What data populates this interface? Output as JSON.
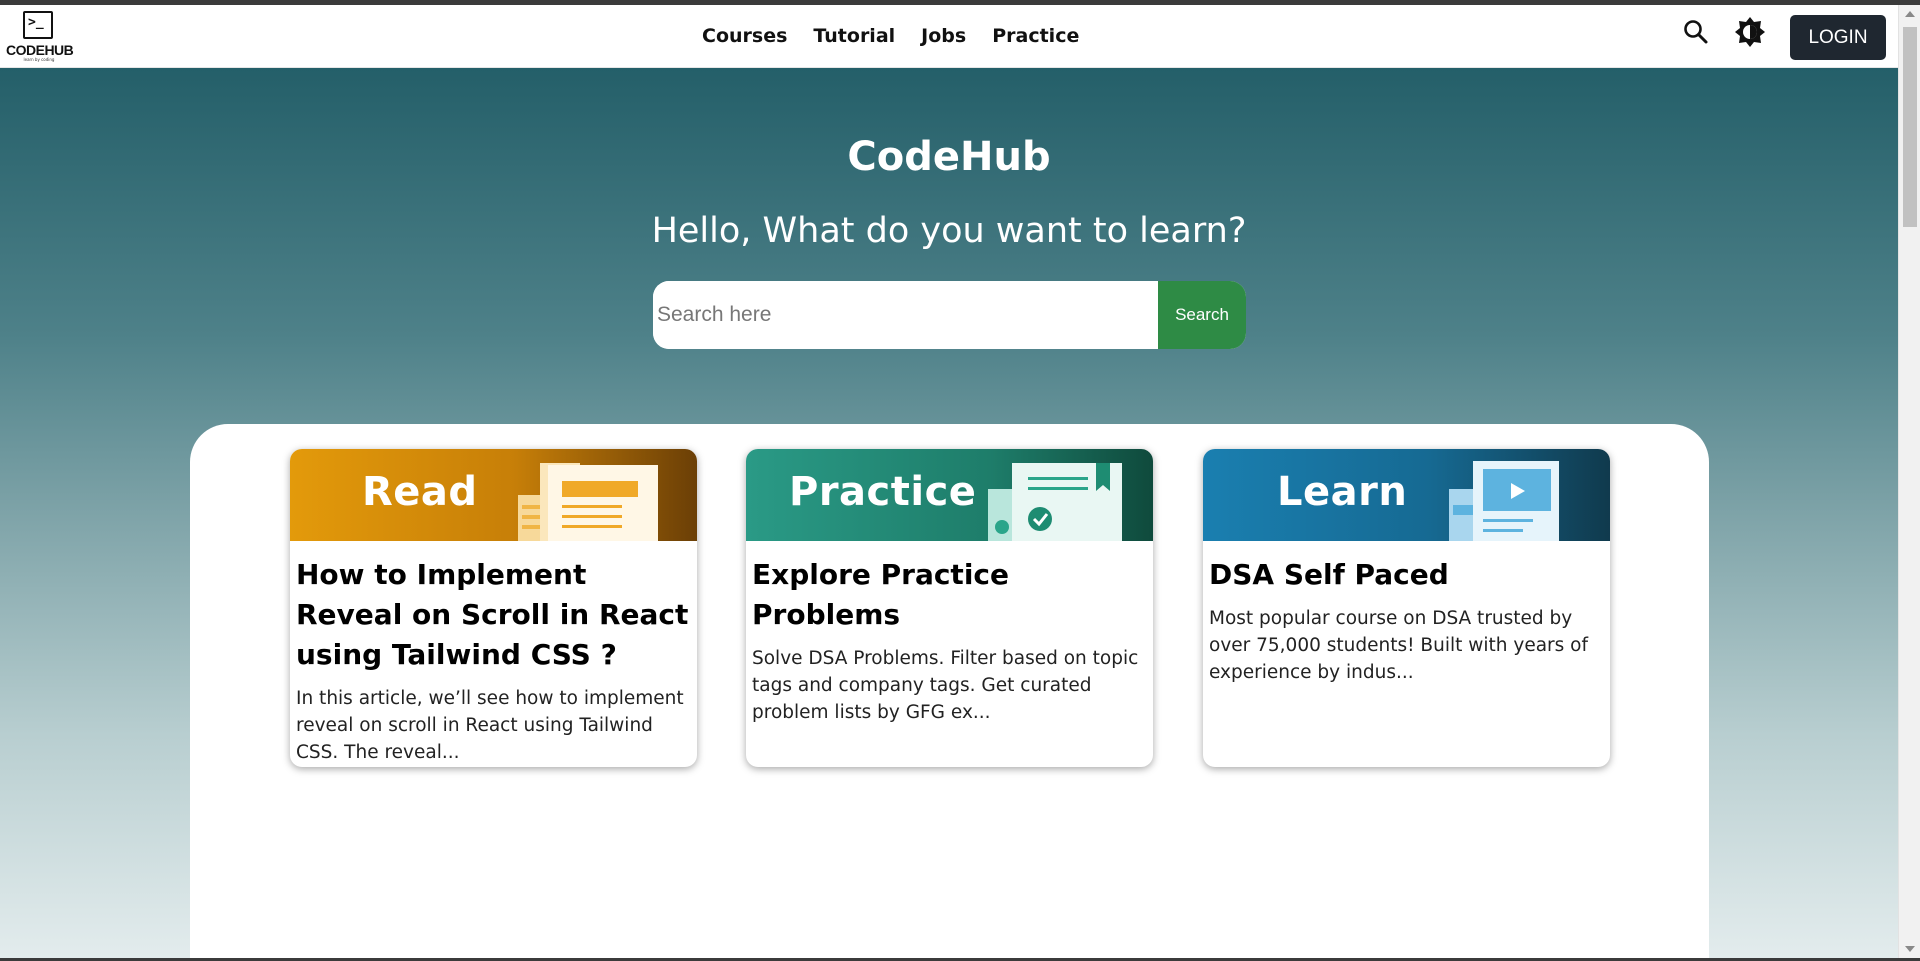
{
  "header": {
    "logo_text": "CODEHUB",
    "logo_tagline": "learn by coding",
    "nav": [
      "Courses",
      "Tutorial",
      "Jobs",
      "Practice"
    ],
    "login_label": "LOGIN",
    "icons": [
      "search-icon",
      "brightness-icon"
    ]
  },
  "hero": {
    "title": "CodeHub",
    "subtitle": "Hello, What do you want to learn?",
    "search_placeholder": "Search here",
    "search_button": "Search",
    "gradient": [
      "#245f69",
      "#e3eced"
    ],
    "search_button_color": "#2e8b45"
  },
  "cards": [
    {
      "banner_word": "Read",
      "banner_colors": [
        "#e39a0b",
        "#6b3f06"
      ],
      "title": "How to Implement Reveal on Scroll in React using Tailwind CSS ?",
      "description": "In this article, we’ll see how to implement reveal on scroll in React using Tailwind CSS. The reveal..."
    },
    {
      "banner_word": "Practice",
      "banner_colors": [
        "#2a9a86",
        "#0f4a3c"
      ],
      "title": "Explore Practice Problems",
      "description": "Solve DSA Problems. Filter based on topic tags and company tags. Get curated problem lists by GFG ex..."
    },
    {
      "banner_word": "Learn",
      "banner_colors": [
        "#1a7fb0",
        "#103a4d"
      ],
      "title": "DSA Self Paced",
      "description": "Most popular course on DSA trusted by over 75,000 students! Built with years of experience by indus..."
    }
  ]
}
